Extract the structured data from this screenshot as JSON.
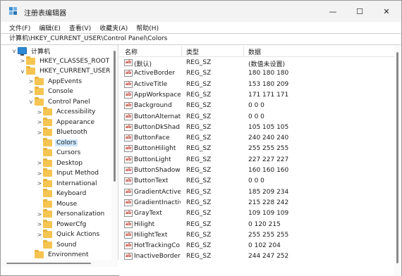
{
  "window": {
    "title": "注册表编辑器",
    "minimize_glyph": "—",
    "maximize_glyph": "☐",
    "close_glyph": "✕"
  },
  "menu": [
    "文件(F)",
    "编辑(E)",
    "查看(V)",
    "收藏夹(A)",
    "帮助(H)"
  ],
  "address": "计算机\\HKEY_CURRENT_USER\\Control Panel\\Colors",
  "tree": [
    {
      "label": "计算机",
      "toggle": "v",
      "icon": "computer-icon"
    },
    {
      "label": "HKEY_CLASSES_ROOT",
      "toggle": ">",
      "icon": "folder-icon"
    },
    {
      "label": "HKEY_CURRENT_USER",
      "toggle": "v",
      "icon": "folder-icon"
    },
    {
      "label": "AppEvents",
      "toggle": ">",
      "icon": "folder-icon"
    },
    {
      "label": "Console",
      "toggle": ">",
      "icon": "folder-icon"
    },
    {
      "label": "Control Panel",
      "toggle": "v",
      "icon": "folder-icon"
    },
    {
      "label": "Accessibility",
      "toggle": ">",
      "icon": "folder-icon"
    },
    {
      "label": "Appearance",
      "toggle": ">",
      "icon": "folder-icon"
    },
    {
      "label": "Bluetooth",
      "toggle": ">",
      "icon": "folder-icon"
    },
    {
      "label": "Colors",
      "toggle": "",
      "icon": "folder-icon",
      "selected": true
    },
    {
      "label": "Cursors",
      "toggle": "",
      "icon": "folder-icon"
    },
    {
      "label": "Desktop",
      "toggle": ">",
      "icon": "folder-icon"
    },
    {
      "label": "Input Method",
      "toggle": ">",
      "icon": "folder-icon"
    },
    {
      "label": "International",
      "toggle": ">",
      "icon": "folder-icon"
    },
    {
      "label": "Keyboard",
      "toggle": "",
      "icon": "folder-icon"
    },
    {
      "label": "Mouse",
      "toggle": "",
      "icon": "folder-icon"
    },
    {
      "label": "Personalization",
      "toggle": ">",
      "icon": "folder-icon"
    },
    {
      "label": "PowerCfg",
      "toggle": ">",
      "icon": "folder-icon"
    },
    {
      "label": "Quick Actions",
      "toggle": ">",
      "icon": "folder-icon"
    },
    {
      "label": "Sound",
      "toggle": "",
      "icon": "folder-icon"
    },
    {
      "label": "Environment",
      "toggle": "",
      "icon": "folder-icon"
    }
  ],
  "columns": {
    "name": "名称",
    "type": "类型",
    "data": "数据"
  },
  "values": [
    {
      "name": "(默认)",
      "type": "REG_SZ",
      "data": "(数值未设置)"
    },
    {
      "name": "ActiveBorder",
      "type": "REG_SZ",
      "data": "180 180 180"
    },
    {
      "name": "ActiveTitle",
      "type": "REG_SZ",
      "data": "153 180 209"
    },
    {
      "name": "AppWorkspace",
      "type": "REG_SZ",
      "data": "171 171 171"
    },
    {
      "name": "Background",
      "type": "REG_SZ",
      "data": "0 0 0"
    },
    {
      "name": "ButtonAlternat...",
      "type": "REG_SZ",
      "data": "0 0 0"
    },
    {
      "name": "ButtonDkShad...",
      "type": "REG_SZ",
      "data": "105 105 105"
    },
    {
      "name": "ButtonFace",
      "type": "REG_SZ",
      "data": "240 240 240"
    },
    {
      "name": "ButtonHilight",
      "type": "REG_SZ",
      "data": "255 255 255"
    },
    {
      "name": "ButtonLight",
      "type": "REG_SZ",
      "data": "227 227 227"
    },
    {
      "name": "ButtonShadow",
      "type": "REG_SZ",
      "data": "160 160 160"
    },
    {
      "name": "ButtonText",
      "type": "REG_SZ",
      "data": "0 0 0"
    },
    {
      "name": "GradientActive...",
      "type": "REG_SZ",
      "data": "185 209 234"
    },
    {
      "name": "GradientInactiv...",
      "type": "REG_SZ",
      "data": "215 228 242"
    },
    {
      "name": "GrayText",
      "type": "REG_SZ",
      "data": "109 109 109"
    },
    {
      "name": "Hilight",
      "type": "REG_SZ",
      "data": "0 120 215"
    },
    {
      "name": "HilightText",
      "type": "REG_SZ",
      "data": "255 255 255"
    },
    {
      "name": "HotTrackingCo...",
      "type": "REG_SZ",
      "data": "0 102 204"
    },
    {
      "name": "InactiveBorder",
      "type": "REG_SZ",
      "data": "244 247 252"
    }
  ],
  "value_icon_label": "ab"
}
